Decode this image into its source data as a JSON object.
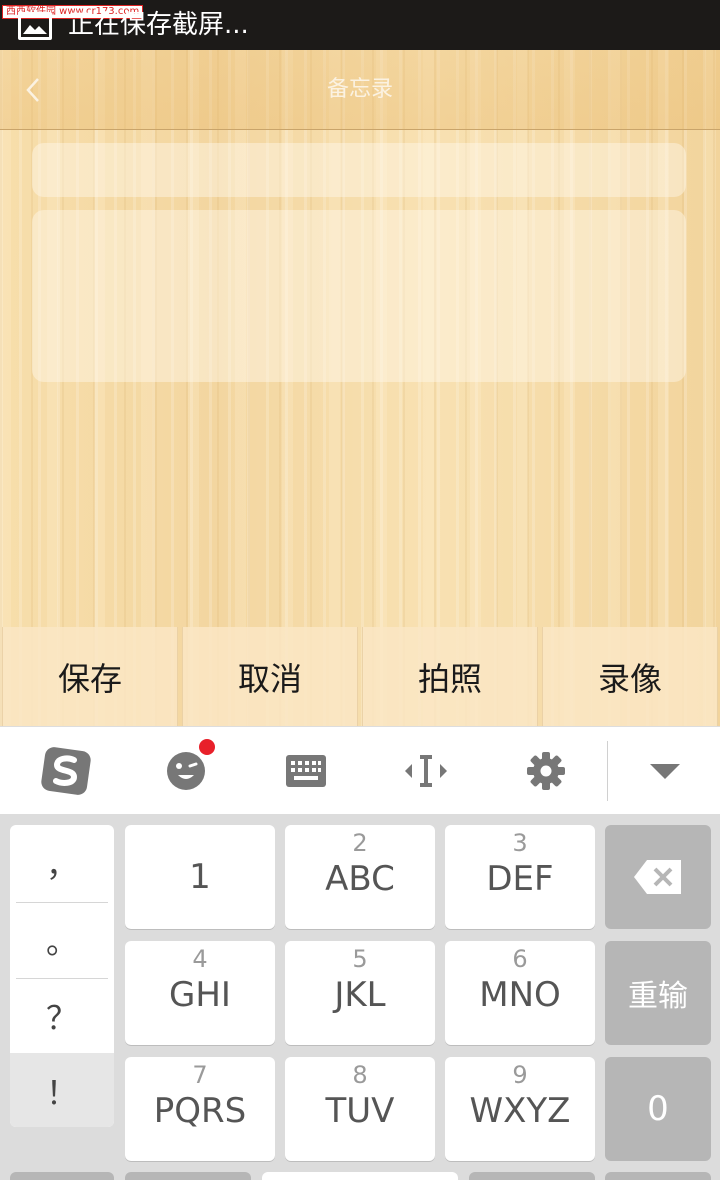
{
  "status_bar": {
    "watermark": "西西软件园 www.cr173.com",
    "notification": "正在保存截屏..."
  },
  "nav": {
    "title": "备忘录"
  },
  "actions": [
    "保存",
    "取消",
    "拍照",
    "录像"
  ],
  "keyboard": {
    "symbols": [
      "，",
      "。",
      "？",
      "！"
    ],
    "keys": [
      {
        "num": "",
        "label": "1"
      },
      {
        "num": "2",
        "label": "ABC"
      },
      {
        "num": "3",
        "label": "DEF"
      },
      {
        "num": "4",
        "label": "GHI"
      },
      {
        "num": "5",
        "label": "JKL"
      },
      {
        "num": "6",
        "label": "MNO"
      },
      {
        "num": "7",
        "label": "PQRS"
      },
      {
        "num": "8",
        "label": "TUV"
      },
      {
        "num": "9",
        "label": "WXYZ"
      }
    ],
    "retype": "重输",
    "zero": "0",
    "toolbar_icons": [
      "sogou-logo-icon",
      "emoji-icon",
      "keyboard-icon",
      "cursor-move-icon",
      "settings-icon",
      "collapse-icon"
    ],
    "colors": {
      "accent_dot": "#e8202a",
      "function_key": "#b6b6b6"
    }
  }
}
